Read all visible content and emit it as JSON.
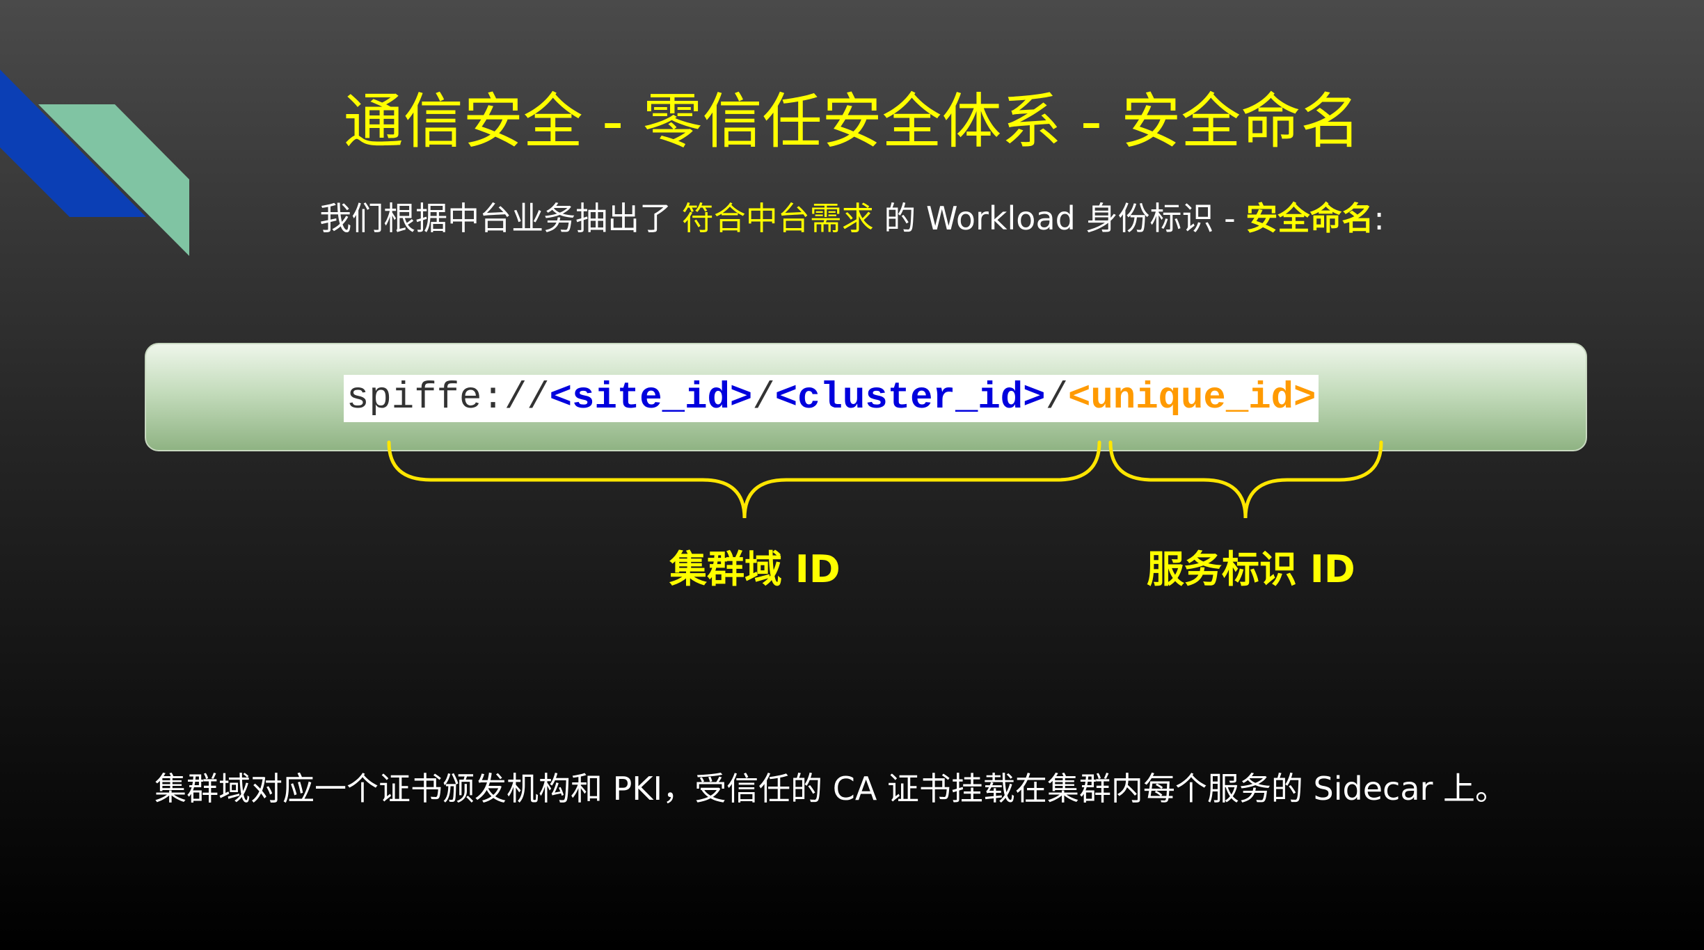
{
  "slide": {
    "title": "通信安全 - 零信任安全体系 - 安全命名",
    "subtitle": {
      "part1": "我们根据中台业务抽出了",
      "highlight": "符合中台需求",
      "part2": "的 Workload 身份标识 -",
      "emphasis": "安全命名",
      "tail": ":"
    },
    "code": {
      "prefix": "spiffe://",
      "site_id": "<site_id>",
      "sep1": "/",
      "cluster_id": "<cluster_id>",
      "sep2": "/",
      "unique_id": "<unique_id>"
    },
    "labels": {
      "cluster_domain": "集群域 ID",
      "service_identity": "服务标识 ID"
    },
    "footer": "集群域对应一个证书颁发机构和 PKI，受信任的 CA 证书挂载在集群内每个服务的 Sidecar 上。"
  },
  "colors": {
    "title": "#ffff00",
    "code_blue": "#0000dd",
    "code_orange": "#ff9a00",
    "deco_blue": "#0b3fb5",
    "deco_green": "#80c4a3",
    "brace": "#ffe600"
  }
}
